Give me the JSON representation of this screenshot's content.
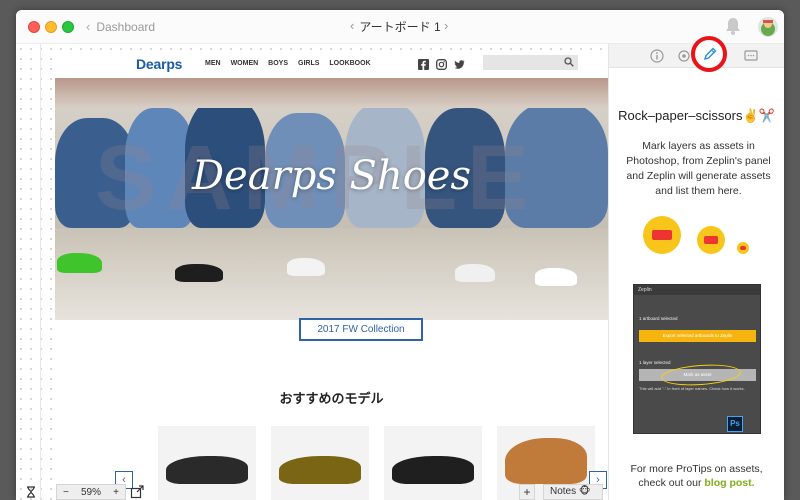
{
  "titlebar": {
    "back_label": "Dashboard",
    "artboard_name": "アートボード 1",
    "prev_arrow": "‹",
    "next_arrow": "›",
    "back_chevron": "‹"
  },
  "artboard": {
    "logo": "Dearps",
    "menu": [
      "MEN",
      "WOMEN",
      "BOYS",
      "GIRLS",
      "LOOKBOOK"
    ],
    "social_icons": [
      "facebook-icon",
      "instagram-icon",
      "twitter-icon"
    ],
    "hero_title": "Dearps Shoes",
    "hero_watermark": "SAMPLE",
    "cta_label": "2017 FW Collection",
    "section_title": "おすすめのモデル",
    "carousel_prev": "‹",
    "carousel_next": "›"
  },
  "bottombar": {
    "zoom_minus": "−",
    "zoom_value": "59%",
    "zoom_plus": "+",
    "add_label": "+",
    "notes_label": "Notes 🐵"
  },
  "panel": {
    "tabs": [
      "info-icon",
      "settings-icon",
      "pen-icon",
      "comment-icon"
    ],
    "tip_title": "Rock–paper–scissors✌️✂️",
    "tip_body": "Mark layers as assets in Photoshop, from Zeplin's panel and Zeplin will generate assets and list them here.",
    "screenshot": {
      "header": "Zeplin",
      "artboard_line": "1 artboard selected",
      "export_button": "Export selected artboards to Zeplin",
      "layer_line": "1 layer selected",
      "mark_button": "Mark as asset",
      "note": "This will add \"-\" in front of layer names. Check how it works.",
      "ps_badge": "Ps"
    },
    "foot_text": "For more ProTips on assets, check out our",
    "foot_link": "blog post.",
    "colors": {
      "link": "#7fae1c",
      "highlight": "#e8141a",
      "brand": "#1b5aa6"
    }
  }
}
